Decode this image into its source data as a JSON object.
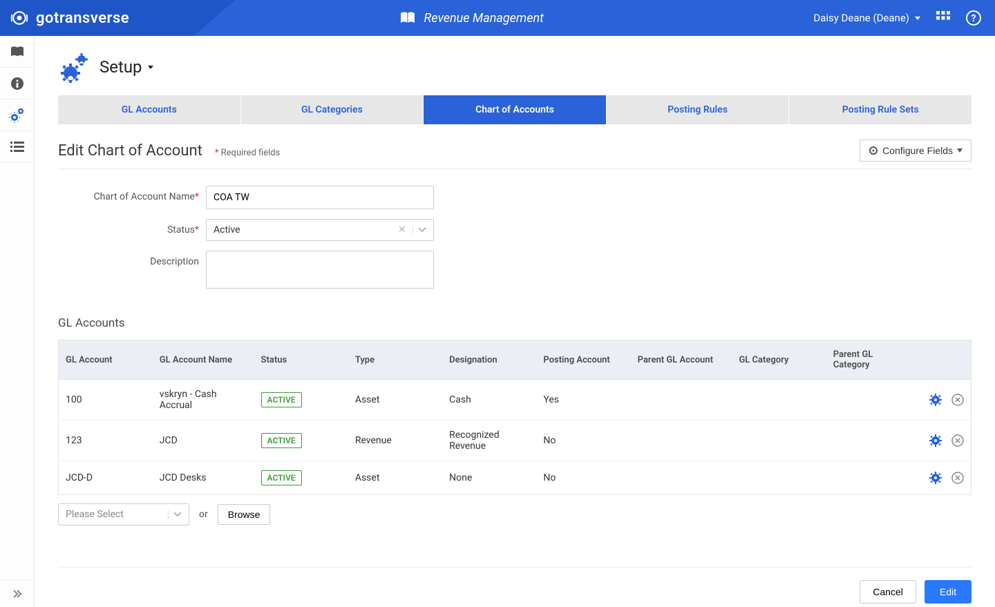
{
  "brand": "gotransverse",
  "header_title": "Revenue Management",
  "user": "Daisy Deane (Deane)",
  "page_title": "Setup",
  "tabs": [
    {
      "label": "GL Accounts"
    },
    {
      "label": "GL Categories"
    },
    {
      "label": "Chart of Accounts"
    },
    {
      "label": "Posting Rules"
    },
    {
      "label": "Posting Rule Sets"
    }
  ],
  "section": {
    "title": "Edit Chart of Account",
    "required_note": "Required fields",
    "configure_label": "Configure Fields"
  },
  "form": {
    "name_label": "Chart of Account Name",
    "name_value": "COA TW",
    "status_label": "Status",
    "status_value": "Active",
    "description_label": "Description",
    "description_value": ""
  },
  "gl_section_title": "GL Accounts",
  "columns": {
    "c0": "GL Account",
    "c1": "GL Account Name",
    "c2": "Status",
    "c3": "Type",
    "c4": "Designation",
    "c5": "Posting Account",
    "c6": "Parent GL Account",
    "c7": "GL Category",
    "c8": "Parent GL Category"
  },
  "rows": [
    {
      "acct": "100",
      "name": "vskryn - Cash Accrual",
      "status": "ACTIVE",
      "type": "Asset",
      "designation": "Cash",
      "posting": "Yes",
      "parent_acct": "",
      "category": "",
      "parent_cat": ""
    },
    {
      "acct": "123",
      "name": "JCD",
      "status": "ACTIVE",
      "type": "Revenue",
      "designation": "Recognized Revenue",
      "posting": "No",
      "parent_acct": "",
      "category": "",
      "parent_cat": ""
    },
    {
      "acct": "JCD-D",
      "name": "JCD Desks",
      "status": "ACTIVE",
      "type": "Asset",
      "designation": "None",
      "posting": "No",
      "parent_acct": "",
      "category": "",
      "parent_cat": ""
    }
  ],
  "below": {
    "select_placeholder": "Please Select",
    "or_label": "or",
    "browse_label": "Browse"
  },
  "footer": {
    "cancel": "Cancel",
    "edit": "Edit"
  }
}
